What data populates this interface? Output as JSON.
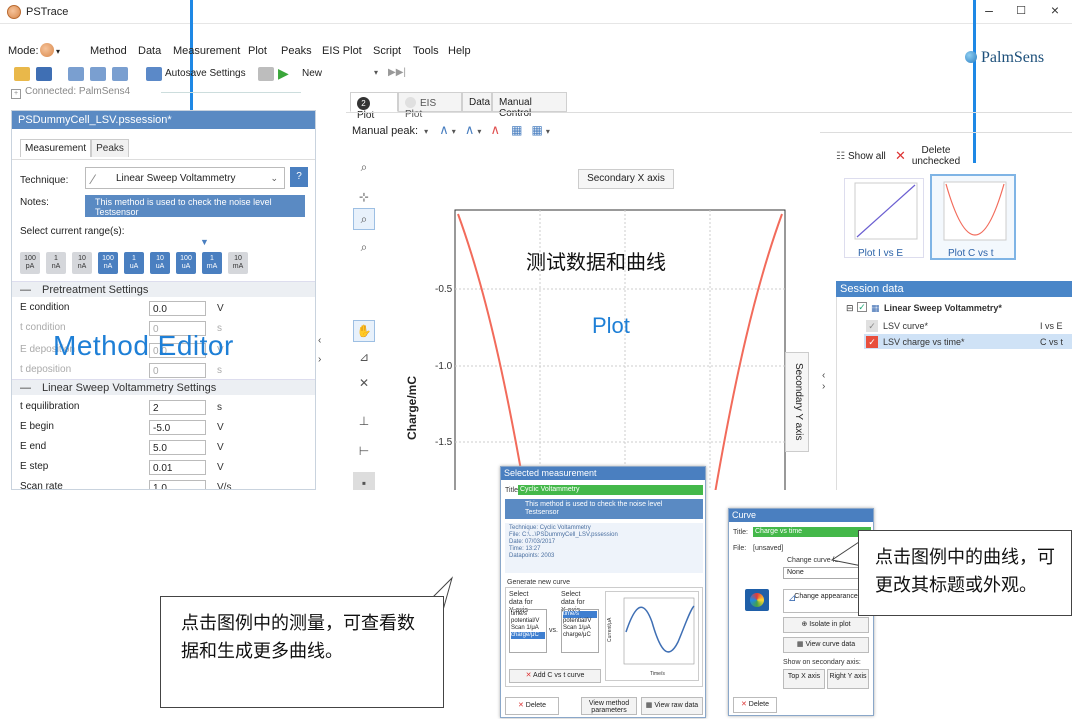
{
  "window": {
    "title": "PSTrace",
    "minimize": "–",
    "maximize": "☐",
    "close": "×"
  },
  "menubar": {
    "mode_label": "Mode:",
    "items": [
      "Method",
      "Data",
      "Measurement",
      "Plot",
      "Peaks",
      "EIS Plot",
      "Script",
      "Tools",
      "Help"
    ]
  },
  "toolbar": {
    "autosave_label": "Autosave Settings",
    "new_label": "New"
  },
  "brand": {
    "name": "PalmSens"
  },
  "connection": {
    "status": "Connected: PalmSens4"
  },
  "method_panel": {
    "session_file": "PSDummyCell_LSV.pssession*",
    "tabs": [
      "Measurement",
      "Peaks"
    ],
    "technique_label": "Technique:",
    "technique_value": "Linear Sweep Voltammetry",
    "help_button": "?",
    "notes_label": "Notes:",
    "notes_text": "This method is used to check the noise level Testsensor",
    "ranges_label": "Select current range(s):",
    "ranges": [
      {
        "value": "100",
        "unit": "pA",
        "on": false
      },
      {
        "value": "1",
        "unit": "nA",
        "on": false
      },
      {
        "value": "10",
        "unit": "nA",
        "on": false
      },
      {
        "value": "100",
        "unit": "nA",
        "on": true
      },
      {
        "value": "1",
        "unit": "uA",
        "on": true
      },
      {
        "value": "10",
        "unit": "uA",
        "on": true
      },
      {
        "value": "100",
        "unit": "uA",
        "on": true
      },
      {
        "value": "1",
        "unit": "mA",
        "on": true
      },
      {
        "value": "10",
        "unit": "mA",
        "on": false
      }
    ],
    "pretreatment_header": "Pretreatment Settings",
    "pretreatment": [
      {
        "label": "E condition",
        "value": "0.0",
        "unit": "V"
      },
      {
        "label": "t condition",
        "value": "0",
        "unit": "s"
      },
      {
        "label": "E deposition",
        "value": "0.0",
        "unit": "V"
      },
      {
        "label": "t deposition",
        "value": "0",
        "unit": "s"
      }
    ],
    "lsv_header": "Linear Sweep Voltammetry Settings",
    "lsv": [
      {
        "label": "t equilibration",
        "value": "2",
        "unit": "s"
      },
      {
        "label": "E begin",
        "value": "-5.0",
        "unit": "V"
      },
      {
        "label": "E end",
        "value": "5.0",
        "unit": "V"
      },
      {
        "label": "E step",
        "value": "0.01",
        "unit": "V"
      },
      {
        "label": "Scan rate",
        "value": "1.0",
        "unit": "V/s"
      }
    ],
    "overlay_label": "Method Editor"
  },
  "plot_tabs": [
    "Plot",
    "EIS Plot",
    "Data",
    "Manual Control"
  ],
  "plot_tab_badge": "2",
  "manual_peak_label": "Manual peak:",
  "plot": {
    "secondary_x": "Secondary X axis",
    "secondary_y": "Secondary Y axis",
    "overlay_cn": "测试数据和曲线",
    "overlay_label": "Plot",
    "ylabel": "Charge/mC",
    "yticks": [
      "-0.5",
      "-1.0",
      "-1.5"
    ]
  },
  "right_panel": {
    "show_all": "Show all",
    "delete_unchecked": "Delete unchecked",
    "thumbs": [
      "Plot I vs E",
      "Plot C vs t"
    ],
    "session_header": "Session data",
    "root_item": "Linear Sweep Voltammetry*",
    "curves": [
      {
        "name": "LSV curve*",
        "kind": "I vs E"
      },
      {
        "name": "LSV charge vs time*",
        "kind": "C vs t"
      }
    ]
  },
  "selected_measurement": {
    "header": "Selected measurement",
    "title_label": "Title",
    "title_value": "Cyclic Voltammetry",
    "notes": "This method is used to check the noise level Testsensor",
    "info": [
      "Technique: Cyclic Voltammetry",
      "File: C:\\...\\PSDummyCell_LSV.pssession",
      "Date: 07/03/2017",
      "Time: 13:27",
      "Datapoints: 2003"
    ],
    "generate_label": "Generate new curve",
    "select_y": "Select data for Y axis",
    "select_x": "Select data for X axis",
    "y_options": [
      "time/s",
      "potential/V",
      "Scan 1/μA",
      "charge/μC"
    ],
    "x_options": [
      "time/s",
      "potential/V",
      "Scan 1/μA",
      "charge/μC"
    ],
    "vs": "vs.",
    "mini_xlabel": "Time/s",
    "mini_ylabel": "Current/μA",
    "add_curve": "Add C vs t curve",
    "delete": "Delete",
    "view_params": "View method parameters",
    "view_raw": "View raw data"
  },
  "curve_panel": {
    "header": "Curve",
    "title_label": "Title:",
    "title_value": "Charge vs time",
    "file_label": "File:",
    "file_value": "[unsaved]",
    "change_fn": "Change curve function:",
    "fn_value": "None",
    "change_appearance": "Change appearance",
    "isolate": "Isolate in plot",
    "view_curve_data": "View curve data",
    "secondary_axis": "Show on secondary axis:",
    "top_x": "Top X axis",
    "right_y": "Right Y axis",
    "delete": "Delete"
  },
  "callout_left": "点击图例中的测量，可查看数据和生成更多曲线。",
  "callout_right": "点击图例中的曲线，可更改其标题或外观。",
  "colors": {
    "accent": "#4a7fc0",
    "curve": "#f26b5b",
    "overlay": "#1e7fd6"
  }
}
